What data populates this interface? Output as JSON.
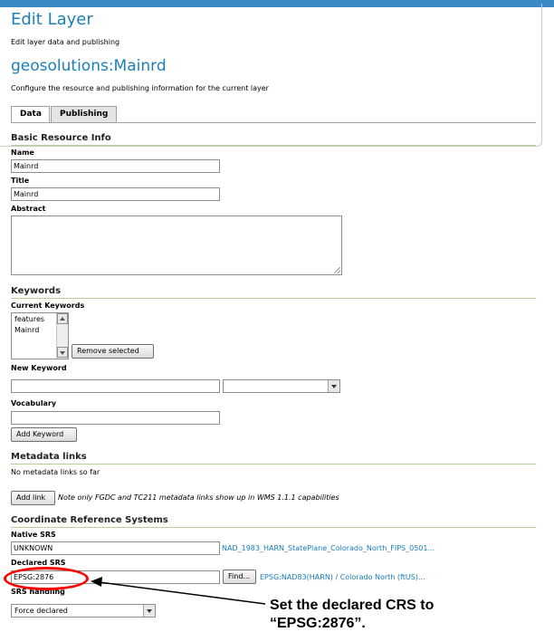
{
  "header": {
    "title": "Edit Layer",
    "subtitle": "Edit layer data and publishing",
    "layer_name": "geosolutions:Mainrd",
    "layer_description": "Configure the resource and publishing information for the current layer"
  },
  "tabs": [
    {
      "label": "Data",
      "active": true
    },
    {
      "label": "Publishing",
      "active": false
    }
  ],
  "basic_info": {
    "section_title": "Basic Resource Info",
    "name_label": "Name",
    "name_value": "Mainrd",
    "title_label": "Title",
    "title_value": "Mainrd",
    "abstract_label": "Abstract",
    "abstract_value": ""
  },
  "keywords": {
    "section_title": "Keywords",
    "current_label": "Current Keywords",
    "items": [
      "features",
      "Mainrd"
    ],
    "remove_button": "Remove selected",
    "new_keyword_label": "New Keyword",
    "new_keyword_value": "",
    "language_value": "",
    "vocabulary_label": "Vocabulary",
    "vocabulary_value": "",
    "add_button": "Add Keyword"
  },
  "metadata": {
    "section_title": "Metadata links",
    "empty_text": "No metadata links so far",
    "add_button": "Add link",
    "note": "Note only FGDC and TC211 metadata links show up in WMS 1.1.1 capabilities"
  },
  "crs": {
    "section_title": "Coordinate Reference Systems",
    "native_label": "Native SRS",
    "native_value": "UNKNOWN",
    "native_link": "NAD_1983_HARN_StatePlane_Colorado_North_FIPS_0501...",
    "declared_label": "Declared SRS",
    "declared_value": "EPSG:2876",
    "find_button": "Find...",
    "declared_link": "EPSG:NAD83(HARN) / Colorado North (ftUS)...",
    "handling_label": "SRS handling",
    "handling_value": "Force declared"
  },
  "annotation": {
    "line1": "Set the declared CRS to",
    "line2": "“EPSG:2876”.",
    "color": "#ff0000"
  },
  "colors": {
    "accent": "#1b7fb8",
    "link": "#1a7ab7",
    "section_rule": "#b9cf9b"
  }
}
